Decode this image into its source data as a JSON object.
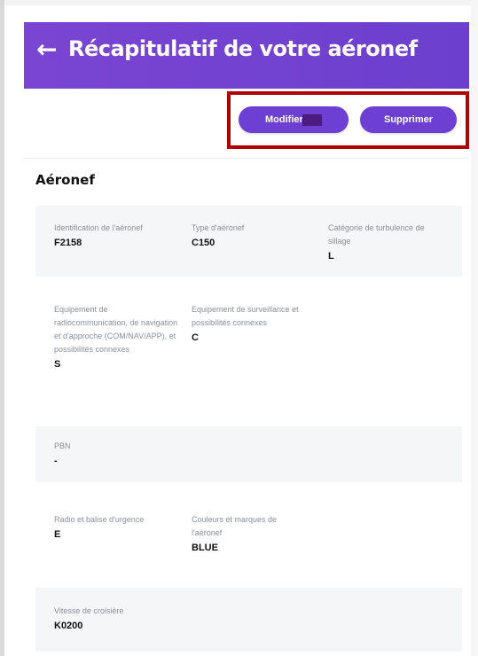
{
  "header": {
    "back_arrow": "←",
    "title": "Récapitulatif de votre aéronef"
  },
  "actions": {
    "modifier_label": "Modifier",
    "supprimer_label": "Supprimer"
  },
  "section": {
    "title": "Aéronef"
  },
  "fields": {
    "identification": {
      "label": "Identification de l'aéronef",
      "value": "F2158"
    },
    "type": {
      "label": "Type d'aéronef",
      "value": "C150"
    },
    "turbulence": {
      "label": "Catégorie de turbulence de sillage",
      "value": "L"
    },
    "com_nav_app": {
      "label": "Equipement de radiocommunication, de navigation et d'approche (COM/NAV/APP), et possibilités connexes",
      "value": "S"
    },
    "surveillance": {
      "label": "Equipement de surveillance et possibilités connexes",
      "value": "C"
    },
    "pbn": {
      "label": "PBN",
      "value": "-"
    },
    "radio_balise": {
      "label": "Radio et balise d'urgence",
      "value": "E"
    },
    "couleurs": {
      "label": "Couleurs et marques de l'aéronef",
      "value": "BLUE"
    },
    "vitesse": {
      "label": "Vitesse de croisière",
      "value": "K0200"
    }
  },
  "colors": {
    "accent": "#6d3fd3",
    "highlight_border": "#b00000",
    "row_bg": "#f4f6f8"
  }
}
